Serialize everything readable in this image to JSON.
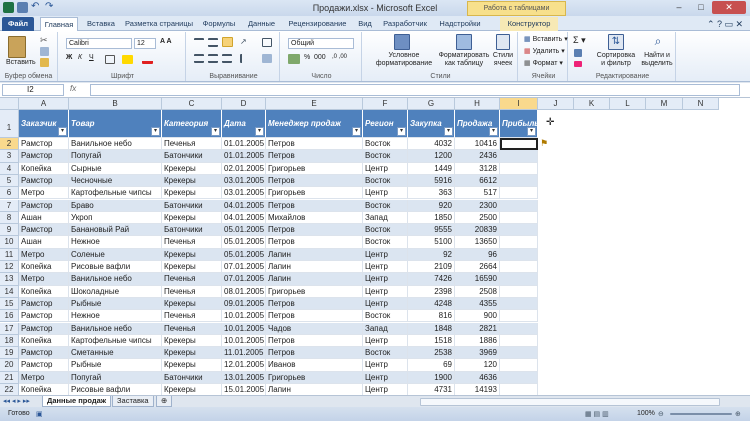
{
  "window": {
    "title": "Продажи.xlsx - Microsoft Excel",
    "context_tab_group": "Работа с таблицами"
  },
  "tabs": [
    {
      "label": "Файл"
    },
    {
      "label": "Главная"
    },
    {
      "label": "Вставка"
    },
    {
      "label": "Разметка страницы"
    },
    {
      "label": "Формулы"
    },
    {
      "label": "Данные"
    },
    {
      "label": "Рецензирование"
    },
    {
      "label": "Вид"
    },
    {
      "label": "Разработчик"
    },
    {
      "label": "Надстройки"
    },
    {
      "label": "Конструктор"
    }
  ],
  "ribbon": {
    "clipboard": {
      "paste": "Вставить",
      "label": "Буфер обмена"
    },
    "font": {
      "family": "Calibri",
      "size": "12",
      "label": "Шрифт"
    },
    "alignment": {
      "label": "Выравнивание"
    },
    "number": {
      "format": "Общий",
      "label": "Число"
    },
    "styles": {
      "conditional": "Условное форматирование",
      "format_as_table": "Форматировать как таблицу",
      "cell_styles": "Стили ячеек",
      "label": "Стили"
    },
    "cells": {
      "insert": "Вставить",
      "delete": "Удалить",
      "format": "Формат",
      "label": "Ячейки"
    },
    "editing": {
      "sort": "Сортировка и фильтр",
      "find": "Найти и выделить",
      "label": "Редактирование"
    }
  },
  "formula_bar": {
    "name_box": "I2",
    "fx": "fx",
    "value": ""
  },
  "columns": [
    "A",
    "B",
    "C",
    "D",
    "E",
    "F",
    "G",
    "H",
    "I",
    "J",
    "K",
    "L",
    "M",
    "N"
  ],
  "table_headers": [
    "Заказчик",
    "Товар",
    "Категория",
    "Дата",
    "Менеджер продаж",
    "Регион",
    "Закупка",
    "Продажа",
    "Прибыль"
  ],
  "rows": [
    [
      "Рамстор",
      "Ванильное небо",
      "Печенья",
      "01.01.2005",
      "Петров",
      "Восток",
      "4032",
      "10416"
    ],
    [
      "Рамстор",
      "Попугай",
      "Батончики",
      "01.01.2005",
      "Петров",
      "Восток",
      "1200",
      "2436"
    ],
    [
      "Копейка",
      "Сырные",
      "Крекеры",
      "02.01.2005",
      "Григорьев",
      "Центр",
      "1449",
      "3128"
    ],
    [
      "Рамстор",
      "Чесночные",
      "Крекеры",
      "03.01.2005",
      "Петров",
      "Восток",
      "5916",
      "6612"
    ],
    [
      "Метро",
      "Картофельные чипсы",
      "Крекеры",
      "03.01.2005",
      "Григорьев",
      "Центр",
      "363",
      "517"
    ],
    [
      "Рамстор",
      "Браво",
      "Батончики",
      "04.01.2005",
      "Петров",
      "Восток",
      "920",
      "2300"
    ],
    [
      "Ашан",
      "Укроп",
      "Крекеры",
      "04.01.2005",
      "Михайлов",
      "Запад",
      "1850",
      "2500"
    ],
    [
      "Рамстор",
      "Банановый Рай",
      "Батончики",
      "05.01.2005",
      "Петров",
      "Восток",
      "9555",
      "20839"
    ],
    [
      "Ашан",
      "Нежное",
      "Печенья",
      "05.01.2005",
      "Петров",
      "Восток",
      "5100",
      "13650"
    ],
    [
      "Метро",
      "Соленые",
      "Крекеры",
      "05.01.2005",
      "Лапин",
      "Центр",
      "92",
      "96"
    ],
    [
      "Копейка",
      "Рисовые вафли",
      "Крекеры",
      "07.01.2005",
      "Лапин",
      "Центр",
      "2109",
      "2664"
    ],
    [
      "Метро",
      "Ванильное небо",
      "Печенья",
      "07.01.2005",
      "Лапин",
      "Центр",
      "7426",
      "16590"
    ],
    [
      "Копейка",
      "Шоколадные",
      "Печенья",
      "08.01.2005",
      "Григорьев",
      "Центр",
      "2398",
      "2508"
    ],
    [
      "Рамстор",
      "Рыбные",
      "Крекеры",
      "09.01.2005",
      "Петров",
      "Центр",
      "4248",
      "4355"
    ],
    [
      "Рамстор",
      "Нежное",
      "Печенья",
      "10.01.2005",
      "Петров",
      "Восток",
      "816",
      "900"
    ],
    [
      "Рамстор",
      "Ванильное небо",
      "Печенья",
      "10.01.2005",
      "Чадов",
      "Запад",
      "1848",
      "2821"
    ],
    [
      "Копейка",
      "Картофельные чипсы",
      "Крекеры",
      "10.01.2005",
      "Петров",
      "Центр",
      "1518",
      "1886"
    ],
    [
      "Рамстор",
      "Сметанные",
      "Крекеры",
      "11.01.2005",
      "Петров",
      "Восток",
      "2538",
      "3969"
    ],
    [
      "Рамстор",
      "Рыбные",
      "Крекеры",
      "12.01.2005",
      "Иванов",
      "Центр",
      "69",
      "120"
    ],
    [
      "Метро",
      "Попугай",
      "Батончики",
      "13.01.2005",
      "Григорьев",
      "Центр",
      "1900",
      "4636"
    ],
    [
      "Копейка",
      "Рисовые вафли",
      "Крекеры",
      "15.01.2005",
      "Лапин",
      "Центр",
      "4731",
      "14193"
    ]
  ],
  "sheets": [
    {
      "label": "Данные продаж"
    },
    {
      "label": "Заставка"
    }
  ],
  "status": {
    "ready": "Готово",
    "zoom": "100%"
  }
}
